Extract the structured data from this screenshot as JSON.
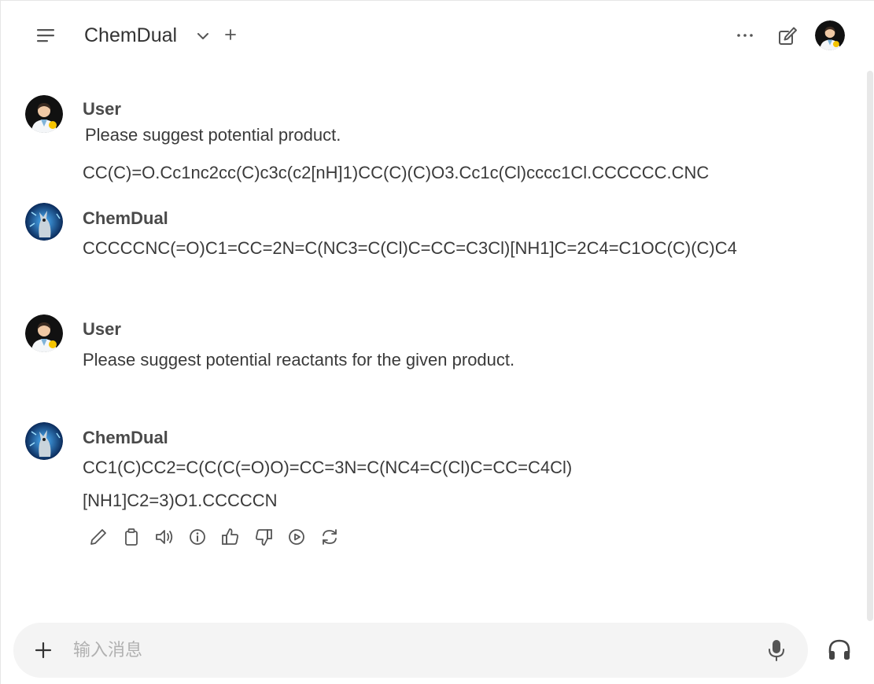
{
  "header": {
    "model_name": "ChemDual"
  },
  "messages": [
    {
      "sender": "User",
      "lines": [
        "Please suggest potential  product."
      ],
      "lines2": [
        "CC(C)=O.Cc1nc2cc(C)c3c(c2[nH]1)CC(C)(C)O3.Cc1c(Cl)cccc1Cl.CCCCCC.CNC"
      ]
    },
    {
      "sender": "ChemDual",
      "lines": [
        "CCCCCNC(=O)C1=CC=2N=C(NC3=C(Cl)C=CC=C3Cl)[NH1]C=2C4=C1OC(C)(C)C4"
      ]
    },
    {
      "sender": "User",
      "lines": [
        "Please suggest potential reactants for the given product."
      ]
    },
    {
      "sender": "ChemDual",
      "lines": [
        "CC1(C)CC2=C(C(C(=O)O)=CC=3N=C(NC4=C(Cl)C=CC=C4Cl)",
        "[NH1]C2=3)O1.CCCCCN"
      ]
    }
  ],
  "actions": [
    "edit-icon",
    "copy-icon",
    "read-aloud-icon",
    "info-icon",
    "thumbs-up-icon",
    "thumbs-down-icon",
    "play-icon",
    "regenerate-icon"
  ],
  "input": {
    "placeholder": "输入消息",
    "value": ""
  },
  "colors": {
    "background": "#ffffff",
    "input_bg": "#f4f4f4",
    "text": "#3a3a3a",
    "icon": "#555555"
  }
}
